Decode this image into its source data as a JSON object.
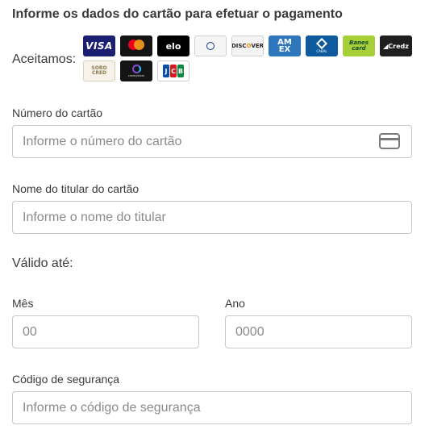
{
  "heading": "Informe os dados do cartão para efetuar o pagamento",
  "accepted_label": "Aceitamos:",
  "brands": [
    {
      "name": "visa",
      "text": "VISA"
    },
    {
      "name": "mastercard",
      "text": "mastercard"
    },
    {
      "name": "elo",
      "text": "elo"
    },
    {
      "name": "diners",
      "text": "Diners Club International"
    },
    {
      "name": "discover",
      "text": "DISCOVER"
    },
    {
      "name": "amex",
      "text": "AMEX"
    },
    {
      "name": "cabal",
      "text": "CABAL"
    },
    {
      "name": "banescard",
      "text": "Banes card"
    },
    {
      "name": "credz",
      "text": "Credz"
    },
    {
      "name": "sorocred",
      "text": "SORO CRED"
    },
    {
      "name": "credsystem",
      "text": "credsystem"
    },
    {
      "name": "jcb",
      "text": "JCB"
    }
  ],
  "card_number": {
    "label": "Número do cartão",
    "placeholder": "Informe o número do cartão"
  },
  "holder_name": {
    "label": "Nome do titular do cartão",
    "placeholder": "Informe o nome do titular"
  },
  "valid_until": {
    "label": "Válido até:"
  },
  "month": {
    "label": "Mês",
    "placeholder": "00"
  },
  "year": {
    "label": "Ano",
    "placeholder": "0000"
  },
  "security_code": {
    "label": "Código de segurança",
    "placeholder": "Informe o código de segurança"
  },
  "icons": {
    "card_field": "credit-card-icon"
  }
}
